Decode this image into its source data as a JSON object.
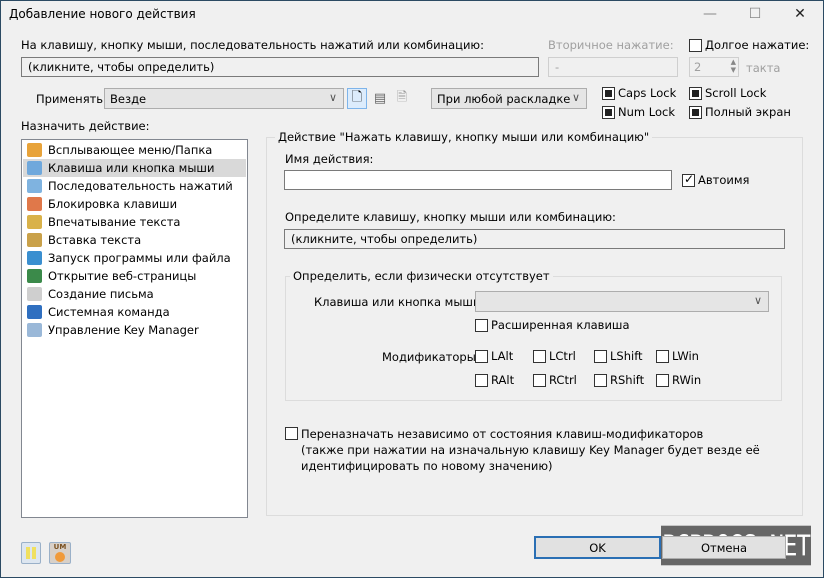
{
  "window": {
    "title": "Добавление нового действия",
    "minimize": "—",
    "maximize": "☐",
    "close": "✕"
  },
  "trigger": {
    "label": "На клавишу, кнопку мыши, последовательность нажатий или комбинацию:",
    "value": "(кликните, чтобы определить)",
    "secondary_label": "Вторичное нажатие:",
    "secondary_value": "-",
    "long_press_label": "Долгое нажатие:",
    "long_press_checked": false,
    "long_press_value": "2",
    "long_press_unit": "такта"
  },
  "apply": {
    "label": "Применять",
    "value": "Везде",
    "icons": [
      "new-doc-icon",
      "properties-icon",
      "document-icon"
    ],
    "layout_value": "При любой раскладке"
  },
  "locks": [
    {
      "label": "Caps Lock",
      "state": "indeterminate"
    },
    {
      "label": "Num Lock",
      "state": "indeterminate"
    },
    {
      "label": "Scroll Lock",
      "state": "indeterminate"
    },
    {
      "label": "Полный экран",
      "state": "indeterminate"
    }
  ],
  "actions": {
    "label": "Назначить действие:",
    "selected": 1,
    "items": [
      {
        "label": "Всплывающее меню/Папка",
        "icon": "menu-folder-icon",
        "color": "#e8a33a"
      },
      {
        "label": "Клавиша или кнопка мыши",
        "icon": "key-icon",
        "color": "#6fa8dc"
      },
      {
        "label": "Последовательность нажатий",
        "icon": "key-sequence-icon",
        "color": "#7fb3e0"
      },
      {
        "label": "Блокировка клавиши",
        "icon": "lock-key-icon",
        "color": "#e0784a"
      },
      {
        "label": "Впечатывание текста",
        "icon": "type-text-icon",
        "color": "#d9b24a"
      },
      {
        "label": "Вставка текста",
        "icon": "paste-text-icon",
        "color": "#c9a14a"
      },
      {
        "label": "Запуск программы или файла",
        "icon": "run-program-icon",
        "color": "#3a8fd0"
      },
      {
        "label": "Открытие веб-страницы",
        "icon": "globe-icon",
        "color": "#3b8a4a"
      },
      {
        "label": "Создание письма",
        "icon": "mail-icon",
        "color": "#cfcfcf"
      },
      {
        "label": "Системная команда",
        "icon": "computer-icon",
        "color": "#2f6fc0"
      },
      {
        "label": "Управление Key Manager",
        "icon": "key-manager-icon",
        "color": "#9ab8d8"
      }
    ]
  },
  "detail": {
    "group_title": "Действие \"Нажать клавишу, кнопку мыши или комбинацию\"",
    "name_label": "Имя действия:",
    "name_value": "",
    "autoname_label": "Автоимя",
    "autoname_checked": true,
    "define_label": "Определите клавишу, кнопку мыши или комбинацию:",
    "define_value": "(кликните, чтобы определить)",
    "absent_group": "Определить, если физически отсутствует",
    "absent_key_label": "Клавиша или кнопка мыши",
    "absent_key_value": "",
    "extended_label": "Расширенная клавиша",
    "modifiers_label": "Модификаторы",
    "modifiers": [
      "LAlt",
      "LCtrl",
      "LShift",
      "LWin",
      "RAlt",
      "RCtrl",
      "RShift",
      "RWin"
    ],
    "remap_lines": [
      "Переназначать независимо от состояния клавиш-модификаторов",
      "(также при нажатии на изначальную клавишу Key Manager будет везде её",
      "идентифицировать по новому значению)"
    ]
  },
  "footer": {
    "ok": "OK",
    "cancel": "Отмена",
    "icons": [
      "pause-icon",
      "um-icon"
    ],
    "um_text": "UM"
  },
  "watermark": "PCPROGS.NET"
}
